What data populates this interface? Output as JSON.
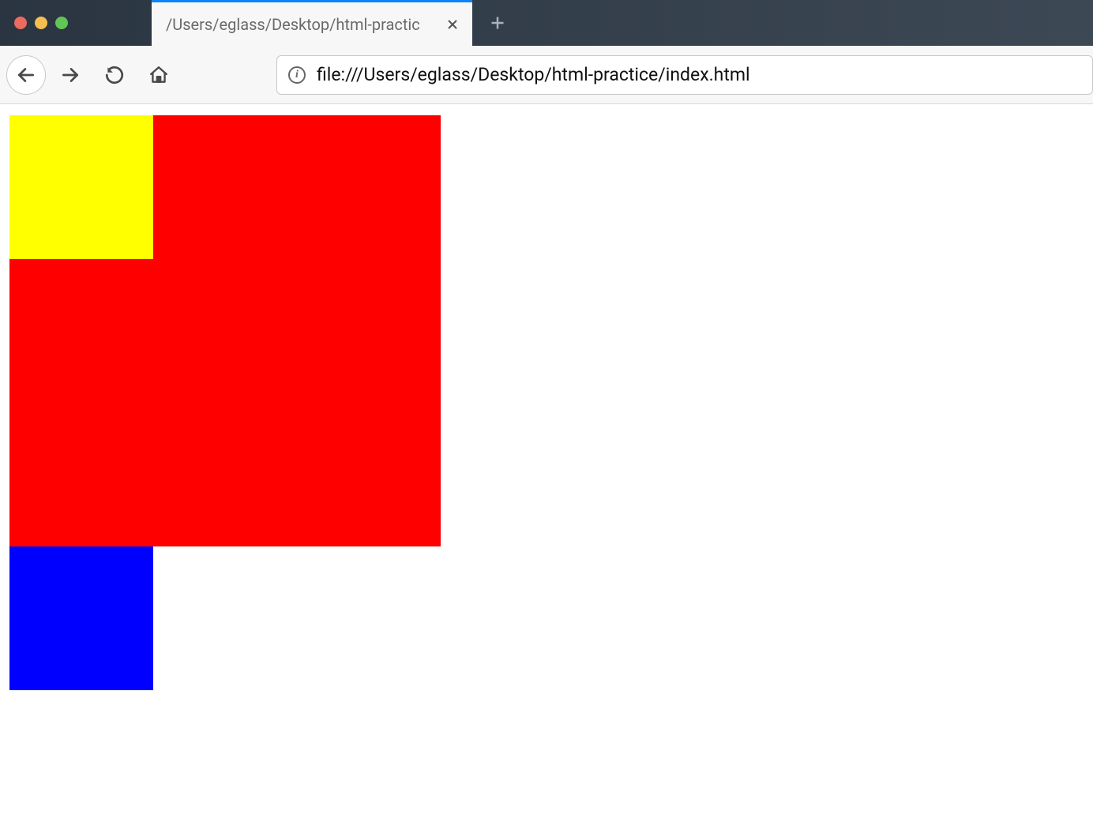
{
  "window": {
    "tab_title": "/Users/eglass/Desktop/html-practic"
  },
  "address": {
    "url": "file:///Users/eglass/Desktop/html-practice/index.html"
  },
  "colors": {
    "red": "#ff0000",
    "yellow": "#ffff00",
    "blue": "#0000ff"
  }
}
